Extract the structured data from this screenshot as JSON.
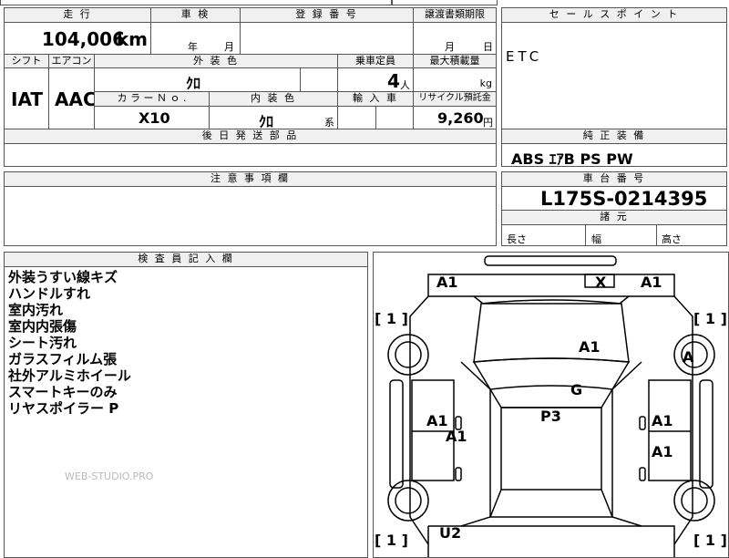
{
  "top": {
    "headers": {
      "mileage": "走 行",
      "inspection": "車 検",
      "registration": "登 録 番 号",
      "transfer": "譲渡書類期限",
      "sales_point": "セ ー ル ス ポ イ ン ト"
    },
    "mileage_value": "104,006",
    "mileage_unit": "km",
    "inspection_year": "年",
    "inspection_month": "月",
    "transfer_month": "月",
    "transfer_day": "日"
  },
  "specs": {
    "labels": {
      "shift": "シフト",
      "aircon": "エアコン",
      "exterior": "外 装 色",
      "capacity": "乗車定員",
      "max_load": "最大積載量",
      "color_no": "カ ラ ー Ｎ ｏ .",
      "interior": "内 装 色",
      "import": "輸 入 車",
      "recycle": "リサイクル預託金"
    },
    "shift": "IAT",
    "aircon": "AAC",
    "exterior_color": "ｸﾛ",
    "capacity": "4",
    "capacity_unit": "人",
    "load_unit": "kg",
    "color_no": "X10",
    "interior_color": "ｸﾛ",
    "interior_suffix": "系",
    "recycle_fee": "9,260",
    "recycle_unit": "円"
  },
  "sales_point_text": "ETC",
  "later_parts_header": "後 日 発 送 部 品",
  "later_parts": "",
  "standard_equipment": {
    "header": "純 正 装 備",
    "value": "ABS ｴｱB PS PW"
  },
  "caution": {
    "header": "注 意 事 項 欄",
    "value": ""
  },
  "chassis": {
    "header": "車 台 番 号",
    "value": "L175S-0214395"
  },
  "dimensions": {
    "header": "諸 元",
    "length": "長さ",
    "width": "幅",
    "height": "高さ"
  },
  "inspector": {
    "header": "検 査 員 記 入 欄",
    "notes": [
      "外装うすい線キズ",
      "ハンドルすれ",
      "室内汚れ",
      "室内内張傷",
      "シート汚れ",
      "ガラスフィルム張",
      "社外アルミホイール",
      "スマートキーのみ",
      "リヤスポイラー P"
    ],
    "watermark": "WEB-STUDIO.PRO"
  },
  "diagram": {
    "marks": [
      "A1",
      "X",
      "A1",
      "A1",
      "A",
      "G",
      "P3",
      "A1",
      "A1",
      "A1",
      "A1",
      "U2"
    ],
    "brackets": [
      "[ 1 ]",
      "[ 1 ]",
      "[ 1 ]",
      "[ 1 ]"
    ]
  }
}
